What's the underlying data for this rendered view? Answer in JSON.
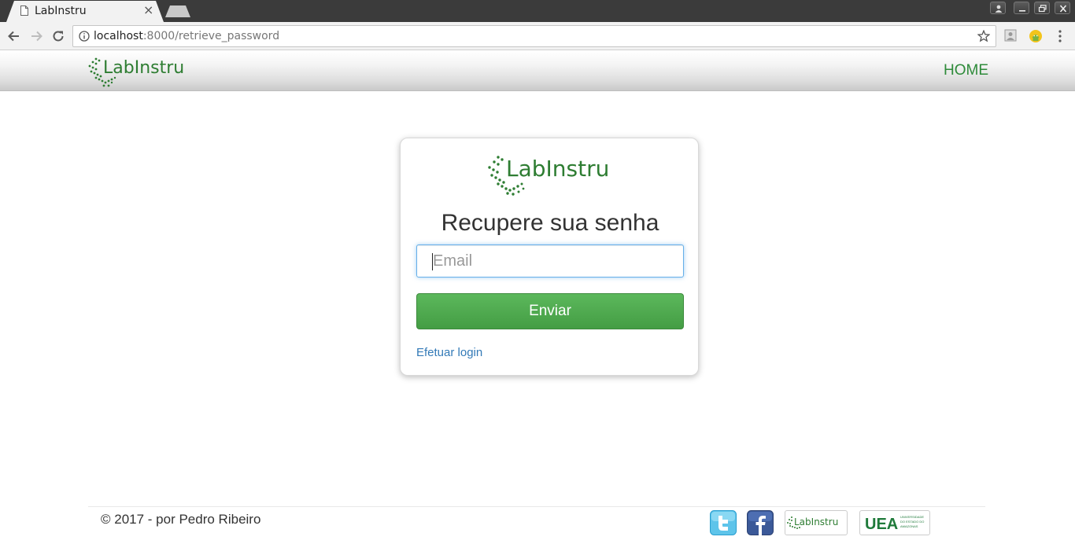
{
  "browser": {
    "tab_title": "LabInstru",
    "url_host": "localhost",
    "url_path": ":8000/retrieve_password"
  },
  "header": {
    "logo_text": "LabInstru",
    "nav_home": "HOME"
  },
  "card": {
    "logo_text": "LabInstru",
    "title": "Recupere sua senha",
    "email_placeholder": "Email",
    "email_value": "",
    "submit_label": "Enviar",
    "login_link": "Efetuar login"
  },
  "footer": {
    "copyright": "© 2017 - por Pedro Ribeiro",
    "badges": {
      "labinstru": "LabInstru",
      "uea": "UEA",
      "uea_small": "UNIVERSIDADE DO ESTADO DO AMAZONAS"
    }
  },
  "colors": {
    "brand_green": "#2e8b3a",
    "button_green": "#4cae4c",
    "link_blue": "#337ab7"
  }
}
